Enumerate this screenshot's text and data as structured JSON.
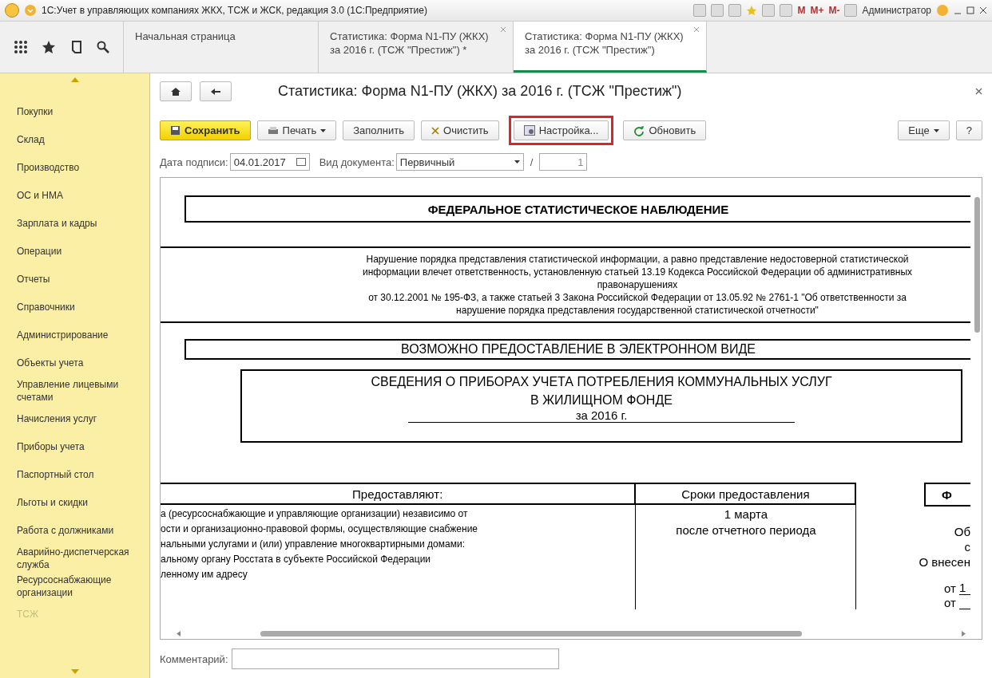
{
  "window": {
    "title": "1С:Учет в управляющих компаниях ЖКХ, ТСЖ и ЖСК, редакция 3.0  (1С:Предприятие)",
    "user": "Администратор",
    "memory_buttons": [
      "M",
      "M+",
      "M-"
    ]
  },
  "tabs": [
    {
      "label": "Начальная страница",
      "selected": false,
      "closable": false
    },
    {
      "label": "Статистика: Форма N1-ПУ (ЖКХ) за 2016 г. (ТСЖ \"Престиж\") *",
      "selected": false,
      "closable": true
    },
    {
      "label": "Статистика: Форма N1-ПУ (ЖКХ) за 2016 г. (ТСЖ \"Престиж\")",
      "selected": true,
      "closable": true
    }
  ],
  "sidebar": {
    "items": [
      {
        "label": "Покупки",
        "faded": false
      },
      {
        "label": "Склад",
        "faded": false
      },
      {
        "label": "Производство",
        "faded": false
      },
      {
        "label": "ОС и НМА",
        "faded": false
      },
      {
        "label": "Зарплата и кадры",
        "faded": false
      },
      {
        "label": "Операции",
        "faded": false
      },
      {
        "label": "Отчеты",
        "faded": false
      },
      {
        "label": "Справочники",
        "faded": false
      },
      {
        "label": "Администрирование",
        "faded": false
      },
      {
        "label": "Объекты учета",
        "faded": false
      },
      {
        "label": "Управление лицевыми счетами",
        "faded": false
      },
      {
        "label": "Начисления услуг",
        "faded": false
      },
      {
        "label": "Приборы учета",
        "faded": false
      },
      {
        "label": "Паспортный стол",
        "faded": false
      },
      {
        "label": "Льготы и скидки",
        "faded": false
      },
      {
        "label": "Работа с должниками",
        "faded": false
      },
      {
        "label": "Аварийно-диспетчерская служба",
        "faded": false
      },
      {
        "label": "Ресурсоснабжающие организации",
        "faded": false
      },
      {
        "label": "ТСЖ",
        "faded": true
      }
    ]
  },
  "form": {
    "title": "Статистика: Форма N1-ПУ (ЖКХ) за 2016 г. (ТСЖ \"Престиж\")",
    "toolbar": [
      {
        "kind": "primary",
        "label": "Сохранить",
        "highlighted": false
      },
      {
        "kind": "print",
        "label": "Печать",
        "highlighted": false
      },
      {
        "kind": "plain",
        "label": "Заполнить",
        "highlighted": false
      },
      {
        "kind": "clear",
        "label": "Очистить",
        "highlighted": false
      },
      {
        "kind": "settings",
        "label": "Настройка...",
        "highlighted": true
      },
      {
        "kind": "refresh",
        "label": "Обновить",
        "highlighted": false
      }
    ],
    "more_button": "Еще",
    "help_button": "?",
    "sign_date_label": "Дата подписи:",
    "sign_date": "04.01.2017",
    "doc_type_label": "Вид документа:",
    "doc_type": "Первичный",
    "separator": "/",
    "number": "1",
    "comment_label": "Комментарий:"
  },
  "document": {
    "header": "ФЕДЕРАЛЬНОЕ СТАТИСТИЧЕСКОЕ НАБЛЮДЕНИЕ",
    "warning": [
      "Нарушение порядка представления статистической информации, а равно представление недостоверной статистической",
      "информации влечет ответственность, установленную статьей 13.19 Кодекса Российской Федерации об административных",
      "правонарушениях",
      "от 30.12.2001 № 195-ФЗ, а также статьей 3 Закона Российской Федерации от 13.05.92 № 2761-1 \"Об ответственности за",
      "нарушение порядка представления государственной статистической отчетности\""
    ],
    "electronic": "ВОЗМОЖНО ПРЕДОСТАВЛЕНИЕ В ЭЛЕКТРОННОМ ВИДЕ",
    "report_title": [
      "СВЕДЕНИЯ О ПРИБОРАХ УЧЕТА ПОТРЕБЛЕНИЯ КОММУНАЛЬНЫХ УСЛУГ",
      "В ЖИЛИЩНОМ ФОНДЕ",
      "за 2016 г."
    ],
    "table": {
      "columns": [
        "Предоставляют:",
        "Сроки предоставления"
      ],
      "provider_lines": [
        "а (ресурсоснабжающие и управляющие организации) независимо от",
        "ости и организационно-правовой формы, осуществляющие снабжение",
        "нальными услугами и (или) управление многоквартирными домами:",
        "альному органу Росстата в субъекте Российской Федерации",
        "ленному им адресу"
      ],
      "deadline_lines": [
        "1 марта",
        "после отчетного периода"
      ]
    },
    "column_3": {
      "heading": "Ф",
      "lines": [
        "Об",
        "с",
        "О внесен"
      ],
      "from_lines": [
        "от",
        "от"
      ],
      "from_value": "1"
    }
  }
}
